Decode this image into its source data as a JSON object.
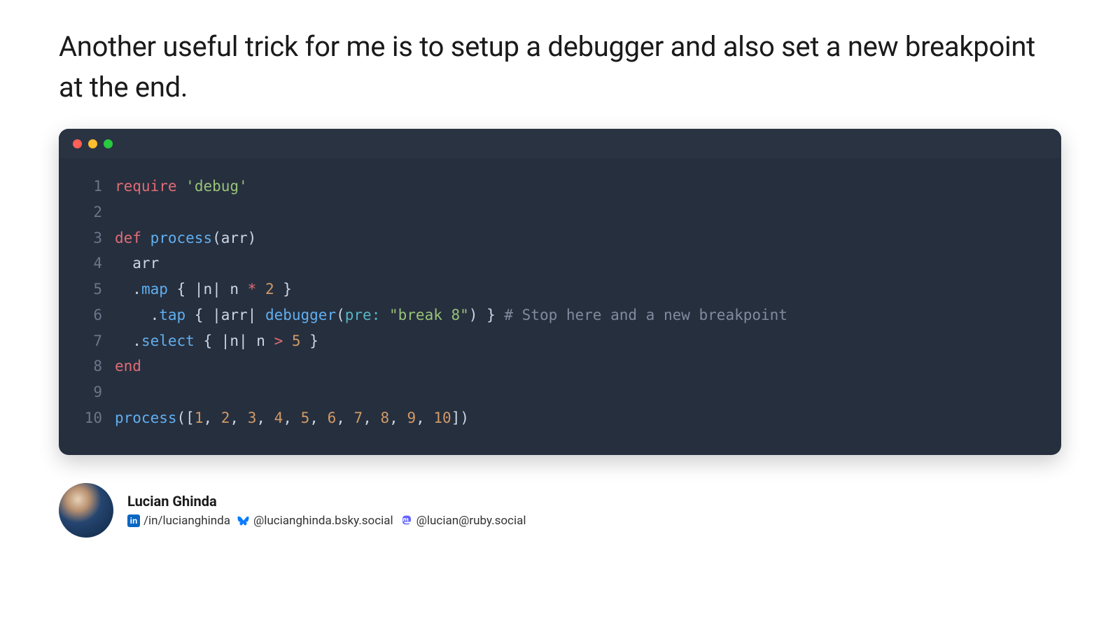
{
  "heading": "Another useful trick for me is to setup a debugger and also set a new breakpoint at the end.",
  "code": {
    "lines": [
      {
        "n": "1",
        "tokens": [
          [
            "kw",
            "require"
          ],
          [
            "plain",
            " "
          ],
          [
            "str",
            "'debug'"
          ]
        ]
      },
      {
        "n": "2",
        "tokens": []
      },
      {
        "n": "3",
        "tokens": [
          [
            "kw",
            "def"
          ],
          [
            "plain",
            " "
          ],
          [
            "fn",
            "process"
          ],
          [
            "plain",
            "(arr)"
          ]
        ]
      },
      {
        "n": "4",
        "tokens": [
          [
            "plain",
            "  arr"
          ]
        ]
      },
      {
        "n": "5",
        "tokens": [
          [
            "plain",
            "  ."
          ],
          [
            "fn",
            "map"
          ],
          [
            "plain",
            " { |n| n "
          ],
          [
            "op",
            "*"
          ],
          [
            "plain",
            " "
          ],
          [
            "num",
            "2"
          ],
          [
            "plain",
            " }"
          ]
        ]
      },
      {
        "n": "6",
        "tokens": [
          [
            "plain",
            "    ."
          ],
          [
            "fn",
            "tap"
          ],
          [
            "plain",
            " { |arr| "
          ],
          [
            "fn",
            "debugger"
          ],
          [
            "plain",
            "("
          ],
          [
            "param",
            "pre:"
          ],
          [
            "plain",
            " "
          ],
          [
            "str",
            "\"break 8\""
          ],
          [
            "plain",
            ") } "
          ],
          [
            "comment",
            "# Stop here and a new breakpoint"
          ]
        ]
      },
      {
        "n": "7",
        "tokens": [
          [
            "plain",
            "  ."
          ],
          [
            "fn",
            "select"
          ],
          [
            "plain",
            " { |n| n "
          ],
          [
            "op",
            ">"
          ],
          [
            "plain",
            " "
          ],
          [
            "num",
            "5"
          ],
          [
            "plain",
            " }"
          ]
        ]
      },
      {
        "n": "8",
        "tokens": [
          [
            "kw",
            "end"
          ]
        ]
      },
      {
        "n": "9",
        "tokens": []
      },
      {
        "n": "10",
        "tokens": [
          [
            "fn",
            "process"
          ],
          [
            "plain",
            "(["
          ],
          [
            "num",
            "1"
          ],
          [
            "plain",
            ", "
          ],
          [
            "num",
            "2"
          ],
          [
            "plain",
            ", "
          ],
          [
            "num",
            "3"
          ],
          [
            "plain",
            ", "
          ],
          [
            "num",
            "4"
          ],
          [
            "plain",
            ", "
          ],
          [
            "num",
            "5"
          ],
          [
            "plain",
            ", "
          ],
          [
            "num",
            "6"
          ],
          [
            "plain",
            ", "
          ],
          [
            "num",
            "7"
          ],
          [
            "plain",
            ", "
          ],
          [
            "num",
            "8"
          ],
          [
            "plain",
            ", "
          ],
          [
            "num",
            "9"
          ],
          [
            "plain",
            ", "
          ],
          [
            "num",
            "10"
          ],
          [
            "plain",
            "])"
          ]
        ]
      }
    ]
  },
  "author": {
    "name": "Lucian Ghinda",
    "linkedin": "/in/lucianghinda",
    "bluesky": "@lucianghinda.bsky.social",
    "mastodon": "@lucian@ruby.social"
  }
}
